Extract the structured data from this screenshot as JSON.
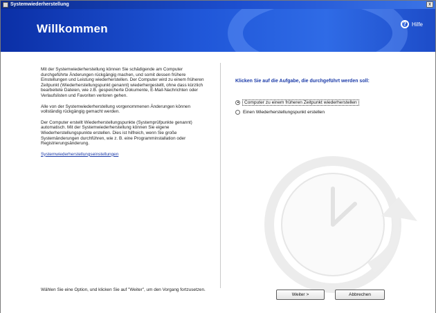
{
  "window": {
    "title": "Systemwiederherstellung",
    "close_label": "x"
  },
  "banner": {
    "heading": "Willkommen",
    "help_icon": "help-icon",
    "help_label": "Hilfe"
  },
  "left": {
    "paragraphs": [
      "Mit der Systemwiederherstellung können Sie schädigende am Computer durchgeführte Änderungen rückgängig machen, und somit dessen frühere Einstellungen und Leistung wiederherstellen. Der Computer wird zu einem früheren Zeitpunkt (Wiederherstellungspunkt genannt) wiederhergestellt, ohne dass kürzlich bearbeitete Dateien, wie z.B. gespeicherte Dokumente, E-Mail-Nachrichten oder Verlaufslisten und Favoriten verloren gehen.",
      "Alle von der Systemwiederherstellung vorgenommenen Änderungen können vollständig rückgängig gemacht werden.",
      "Der Computer erstellt Wiederherstellungspunkte (Systemprüfpunkte genannt) automatisch. Mit der Systemwiederherstellung können Sie eigene Wiederherstellungspunkte erstellen. Dies ist hilfreich, wenn Sie große Systemänderungen durchführen, wie z. B. eine Programminstallation oder Registrierungsänderung."
    ],
    "settings_link": "Systemwiederherstellungseinstellungen",
    "footer": "Wählen Sie eine Option, und klicken Sie auf \"Weiter\", um den Vorgang fortzusetzen."
  },
  "right": {
    "heading": "Klicken Sie auf die Aufgabe, die durchgeführt werden soll:",
    "options": [
      {
        "label": "Computer zu einem früheren Zeitpunkt wiederherstellen",
        "selected": true
      },
      {
        "label": "Einen Wiederherstellungspunkt erstellen",
        "selected": false
      }
    ]
  },
  "buttons": {
    "next": "Weiter >",
    "cancel": "Abbrechen"
  },
  "colors": {
    "banner": "#1f56d8",
    "heading_text": "#1a3aa8"
  }
}
